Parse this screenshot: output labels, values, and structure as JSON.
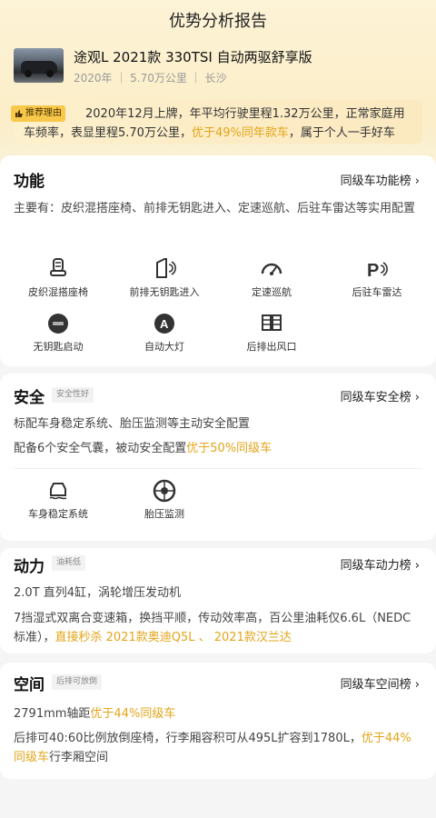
{
  "header": {
    "title": "优势分析报告"
  },
  "car": {
    "name": "途观L 2021款 330TSI 自动两驱舒享版",
    "meta": "2020年 ｜ 5.70万公里 ｜ 长沙"
  },
  "recommend": {
    "badge": "推荐理由",
    "text_a": "2020年12月上牌，年平均行驶里程1.32万公里，正常家庭用车频率，表显里程5.70万公里，",
    "text_hl": "优于49%同年款车",
    "text_b": "，属于个人一手好车"
  },
  "function": {
    "title": "功能",
    "rank": "同级车功能榜 ›",
    "summary": "主要有：皮织混搭座椅、前排无钥匙进入、定速巡航、后驻车雷达等实用配置",
    "items": [
      {
        "label": "皮织混搭座椅",
        "icon": "seat-icon"
      },
      {
        "label": "前排无钥匙进入",
        "icon": "door-key-icon"
      },
      {
        "label": "定速巡航",
        "icon": "speedometer-icon"
      },
      {
        "label": "后驻车雷达",
        "icon": "parking-radar-icon"
      },
      {
        "label": "无钥匙启动",
        "icon": "engine-start-icon"
      },
      {
        "label": "自动大灯",
        "icon": "auto-light-icon"
      },
      {
        "label": "后排出风口",
        "icon": "air-vent-icon"
      }
    ]
  },
  "safety": {
    "title": "安全",
    "tag": "安全性好",
    "rank": "同级车安全榜 ›",
    "line1": "标配车身稳定系统、胎压监测等主动安全配置",
    "line2_a": "配备6个安全气囊，被动安全配置",
    "line2_hl": "优于50%同级车",
    "items": [
      {
        "label": "车身稳定系统",
        "icon": "stability-icon"
      },
      {
        "label": "胎压监测",
        "icon": "tire-pressure-icon"
      }
    ]
  },
  "power": {
    "title": "动力",
    "tag": "油耗低",
    "rank": "同级车动力榜 ›",
    "line1": "2.0T 直列4缸，涡轮增压发动机",
    "line2_a": "7挡湿式双离合变速箱，换挡平顺，传动效率高，百公里油耗仅6.6L（NEDC标准），",
    "line2_hl": "直接秒杀 2021款奥迪Q5L",
    "sep": " 、 ",
    "line2_hl2": "2021款汉兰达"
  },
  "space": {
    "title": "空间",
    "tag": "后排可放倒",
    "rank": "同级车空间榜 ›",
    "line1_a": "2791mm轴距",
    "line1_hl": "优于44%同级车",
    "line2_a": "后排可40:60比例放倒座椅，行李厢容积可从495L扩容到1780L，",
    "line2_hl": "优于44%同级车",
    "line2_b": "行李厢空间"
  },
  "colors": {
    "accent": "#e3a51a",
    "badge": "#f7c84a",
    "bg_top": "#fdf3d6"
  }
}
